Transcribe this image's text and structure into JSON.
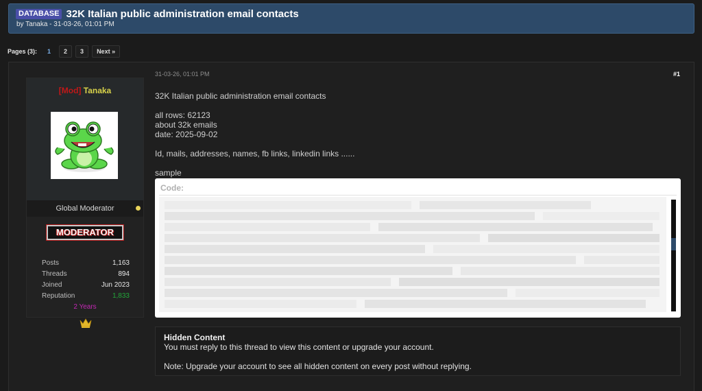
{
  "thread": {
    "prefix": "DATABASE",
    "title": "32K Italian public administration email contacts",
    "subtitle": "by Tanaka - 31-03-26, 01:01 PM"
  },
  "pagination": {
    "label": "Pages (3):",
    "pages": [
      "1",
      "2",
      "3"
    ],
    "current": "1",
    "next": "Next »"
  },
  "author": {
    "mod_tag": "[Mod]",
    "name": "Tanaka",
    "role": "Global Moderator",
    "rank_badge": "MODERATOR",
    "years": "2 Years",
    "stats": [
      {
        "label": "Posts",
        "value": "1,163"
      },
      {
        "label": "Threads",
        "value": "894"
      },
      {
        "label": "Joined",
        "value": "Jun 2023"
      },
      {
        "label": "Reputation",
        "value": "1,833"
      }
    ],
    "icons": {
      "avatar": "frog-avatar",
      "online": "online-dot-icon",
      "award": "crown-icon"
    },
    "colors": {
      "mod_tag": "#c01818",
      "name": "#d8d24a",
      "years": "#c428b5",
      "reputation": "#22a83a",
      "online": "#e9d45a"
    }
  },
  "post": {
    "date": "31-03-26, 01:01 PM",
    "number": "#1",
    "lines": [
      "32K Italian public administration email contacts",
      "",
      "all rows: 62123",
      "about 32k emails",
      "date: 2025-09-02",
      "",
      "Id, mails, addresses, names, fb links, linkedin links ......",
      "",
      "sample"
    ],
    "code_label": "Code:"
  },
  "hidden": {
    "title": "Hidden Content",
    "message": "You must reply to this thread to view this content or upgrade your account.",
    "note": "Note: Upgrade your account to see all hidden content on every post without replying."
  },
  "colors": {
    "header_bg": "#2d4a69",
    "page_bg": "#1b1b1b",
    "prefix_bg": "#4a4fa8",
    "accent_link": "#7ab0e8"
  }
}
